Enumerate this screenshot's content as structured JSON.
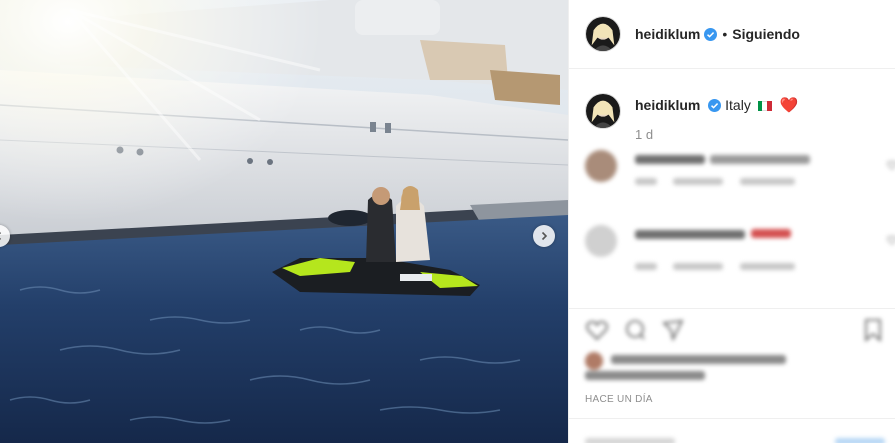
{
  "post": {
    "username": "heidiklum",
    "follow_status": "Siguiendo",
    "separator": "•",
    "caption_text": "Italy",
    "caption_heart": "❤️",
    "time_ago": "1 d",
    "date_label": "HACE UN DÍA"
  },
  "icons": {
    "verified": "verified-badge-icon",
    "flag": "italy-flag",
    "next": "chevron-right-icon",
    "prev": "chevron-left-icon",
    "like": "heart-outline-icon",
    "comment": "comment-icon",
    "share": "share-icon",
    "save": "bookmark-icon"
  },
  "colors": {
    "verified": "#3897f0",
    "heart": "#e0245e",
    "jetski_accent": "#b5e61d",
    "sea": "#1e3a66"
  }
}
